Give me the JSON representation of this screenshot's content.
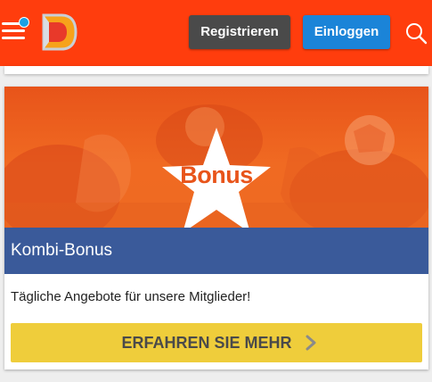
{
  "header": {
    "register_label": "Registrieren",
    "login_label": "Einloggen",
    "brand_color": "#ff3d0d",
    "menu_icon": "hamburger-menu-icon",
    "search_icon": "search-icon",
    "notification_dot_color": "#1aa0e6"
  },
  "promo": {
    "badge_text": "Bonus",
    "title": "Kombi-Bonus",
    "description": "Tägliche Angebote für unsere Mitglieder!",
    "cta_label": "ERFAHREN SIE MEHR",
    "cta_color": "#efcd3b",
    "title_band_color": "#3a5a9a"
  }
}
